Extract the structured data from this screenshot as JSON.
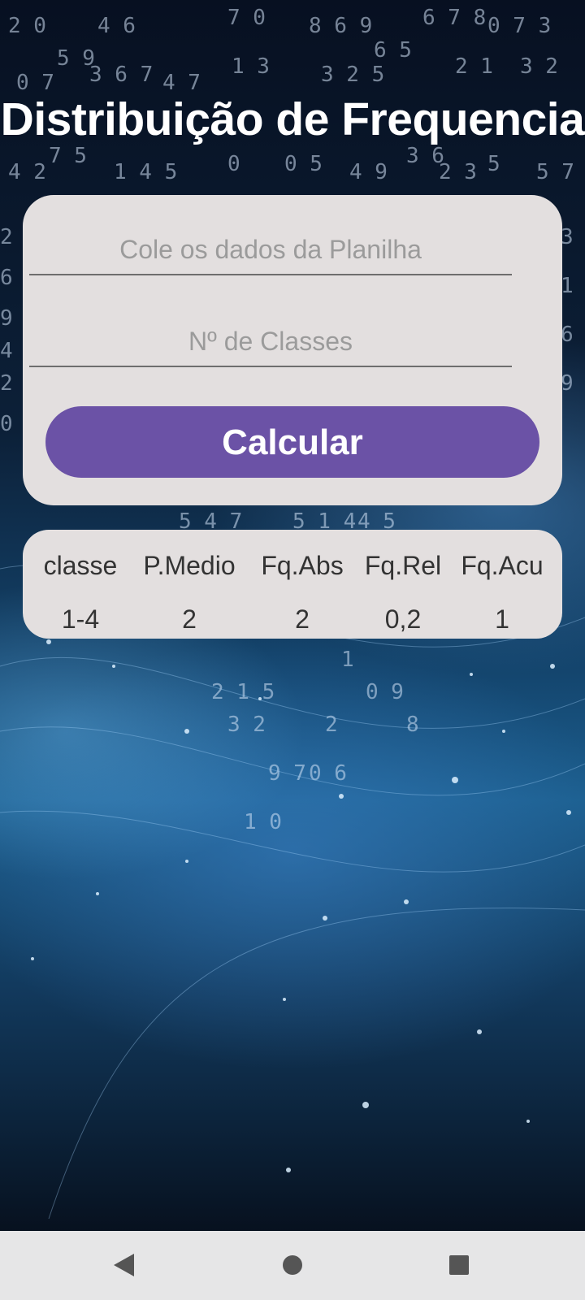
{
  "page": {
    "title": "Distribuição de Frequencia"
  },
  "form": {
    "dados_placeholder": "Cole os dados da Planilha",
    "dados_value": "",
    "classes_placeholder": "Nº de Classes",
    "classes_value": "",
    "calcular_label": "Calcular"
  },
  "results": {
    "headers": [
      "classe",
      "P.Medio",
      "Fq.Abs",
      "Fq.Rel",
      "Fq.Acu"
    ],
    "rows": [
      [
        "1-4",
        "2",
        "2",
        "0,2",
        "1"
      ]
    ]
  },
  "nav": {
    "back_icon": "back-triangle-icon",
    "home_icon": "home-circle-icon",
    "recents_icon": "recents-square-icon"
  },
  "colors": {
    "button": "#6b52a6",
    "card": "#e3dfdf",
    "title": "#ffffff",
    "nav_bar": "#e6e6e7"
  }
}
